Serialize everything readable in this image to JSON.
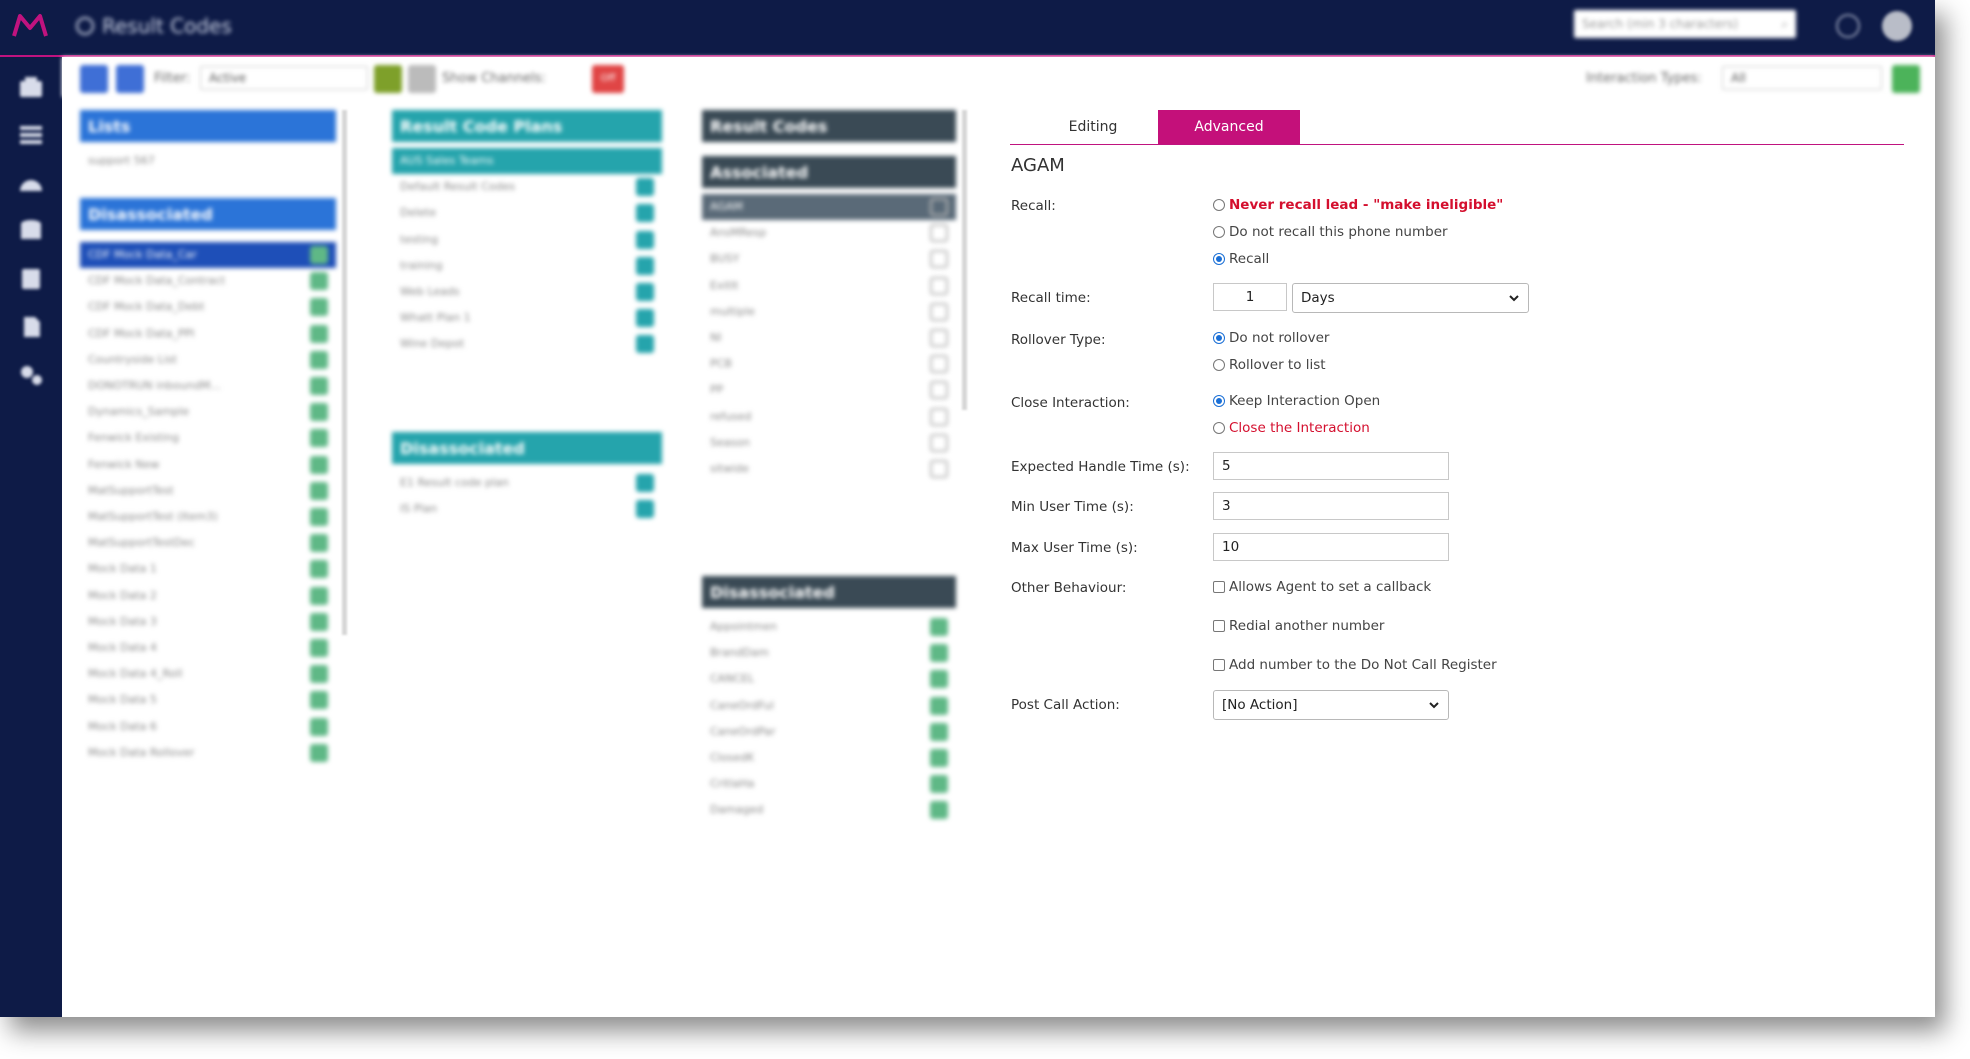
{
  "header": {
    "title": "Result Codes",
    "search_placeholder": "Search (min 3 characters)"
  },
  "toolbar": {
    "filter_label": "Filter:",
    "filter_value": "Active",
    "show_channels_label": "Show Channels:",
    "toggle_label": "Off",
    "interaction_types_label": "Interaction Types:",
    "interaction_types_value": "All"
  },
  "lists": {
    "header": "Lists",
    "items": [
      "support 567"
    ],
    "disassociated_header": "Disassociated",
    "disassociated_items": [
      "CDF Mock Data_Car",
      "CDF Mock Data_Contract",
      "CDF Mock Data_Debt",
      "CDF Mock Data_PPI",
      "Countryside List",
      "DONOTRUN inboundM...",
      "Dynamics_Sample",
      "Fenwick Existing",
      "Fenwick New",
      "MatSupportTest",
      "MatSupportTest (Item3)",
      "MatSupportTestDec",
      "Mock Data 1",
      "Mock Data 2",
      "Mock Data 3",
      "Mock Data 4",
      "Mock Data 4_Roll",
      "Mock Data 5",
      "Mock Data 6",
      "Mock Data Rollover"
    ]
  },
  "plans": {
    "header": "Result Code Plans",
    "items": [
      "AUS Sales Teams",
      "Default Result Codes",
      "Delete",
      "testing",
      "training",
      "Web Leads",
      "Whatt Plan 1",
      "Wine Depot"
    ],
    "disassociated_header": "Disassociated",
    "disassociated_items": [
      "E1 Result code plan",
      "IS Plan"
    ]
  },
  "codes": {
    "header": "Result Codes",
    "associated_header": "Associated",
    "associated_items": [
      "AGAM",
      "AnsMResp",
      "BUSY",
      "ExitIt",
      "multiple",
      "NI",
      "PCB",
      "PP",
      "refused",
      "Season",
      "sitwide"
    ],
    "disassociated_header": "Disassociated",
    "disassociated_items": [
      "Appointmen",
      "BrandDam",
      "CANCEL",
      "CaneOrdFul",
      "CaneOrdPar",
      "ClosedK",
      "CritlaHa",
      "Damaged"
    ]
  },
  "detail": {
    "tabs": [
      "Editing",
      "Advanced"
    ],
    "code_name": "AGAM",
    "recall_label": "Recall:",
    "recall_options": [
      "Never recall lead - \"make ineligible\"",
      "Do not recall this phone number",
      "Recall"
    ],
    "recall_time_label": "Recall time:",
    "recall_time_value": "1",
    "recall_unit": "Days",
    "rollover_label": "Rollover Type:",
    "rollover_options": [
      "Do not rollover",
      "Rollover to list"
    ],
    "close_label": "Close Interaction:",
    "close_options": [
      "Keep Interaction Open",
      "Close the Interaction"
    ],
    "eht_label": "Expected Handle Time (s):",
    "eht_value": "5",
    "min_label": "Min User Time (s):",
    "min_value": "3",
    "max_label": "Max User Time (s):",
    "max_value": "10",
    "other_label": "Other Behaviour:",
    "other_options": [
      "Allows Agent to set a callback",
      "Redial another number",
      "Add number to the Do Not Call Register"
    ],
    "post_label": "Post Call Action:",
    "post_value": "[No Action]"
  },
  "colors": {
    "navy": "#0e1b47",
    "magenta": "#c4107a",
    "blue": "#2b74d8",
    "teal": "#25a4ac",
    "slate": "#3a4a55",
    "green": "#5fb886",
    "red_text": "#d40f2e"
  }
}
